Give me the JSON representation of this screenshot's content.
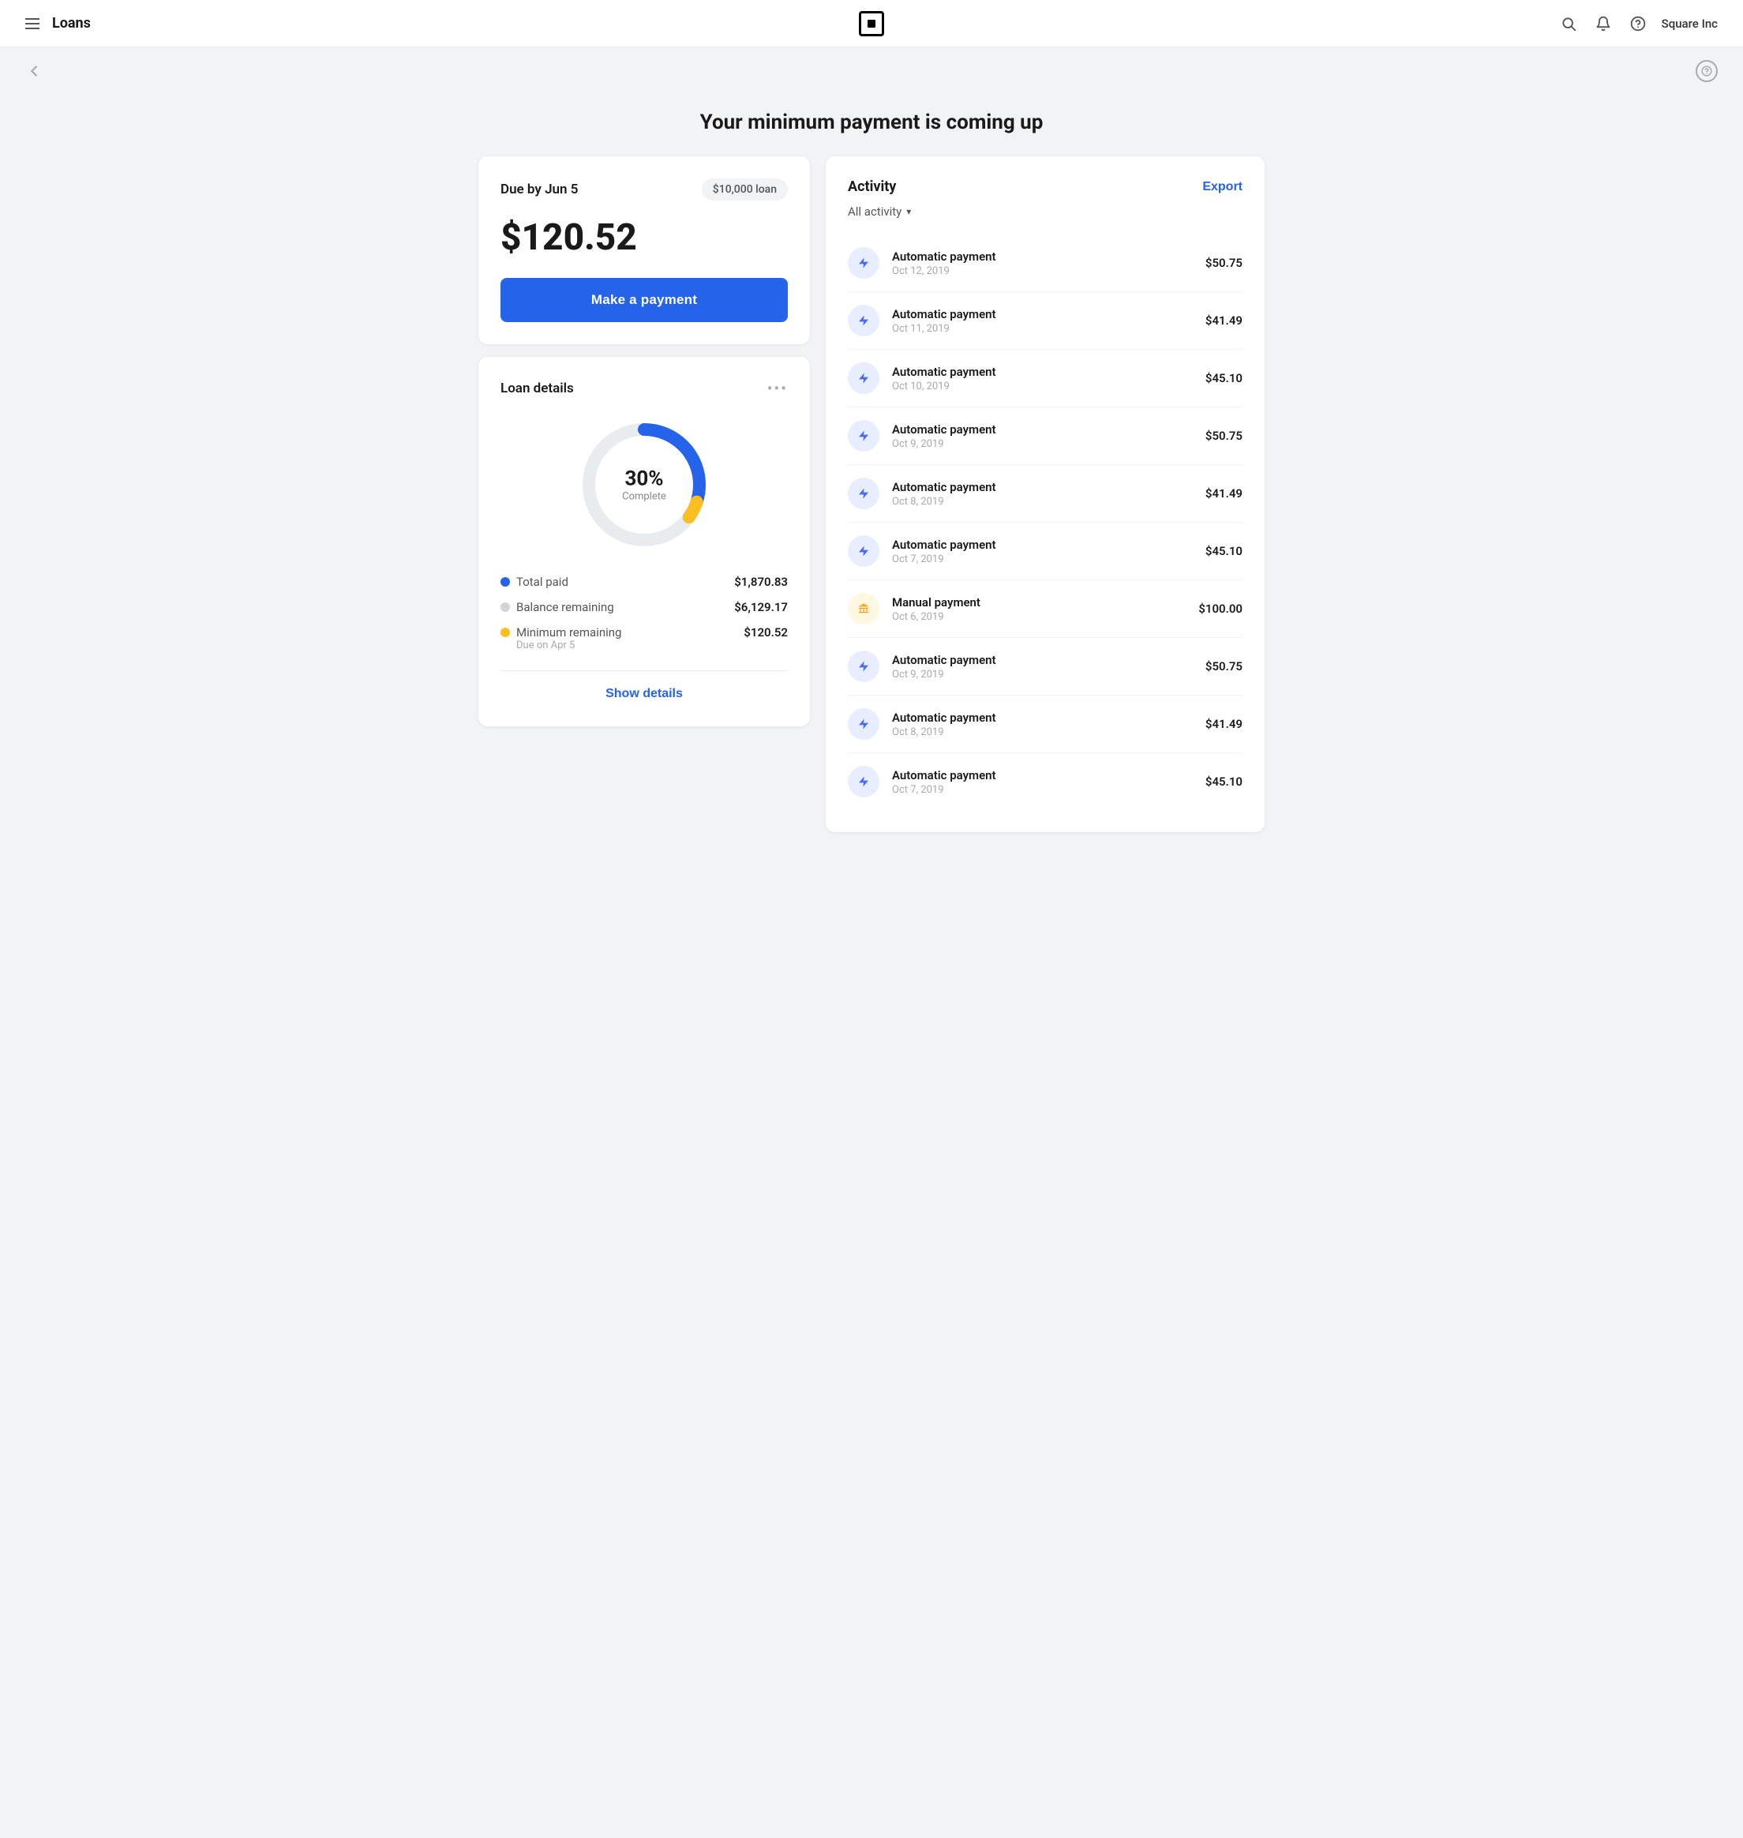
{
  "header": {
    "menu_icon": "☰",
    "title": "Loans",
    "logo_label": "Square logo",
    "search_icon": "🔍",
    "bell_icon": "🔔",
    "help_icon": "?",
    "user": "Square Inc"
  },
  "nav": {
    "back_icon": "←",
    "help_icon": "?"
  },
  "page": {
    "title": "Your minimum payment is coming up"
  },
  "payment_card": {
    "due_label": "Due by Jun 5",
    "loan_badge": "$10,000 loan",
    "amount": "$120.52",
    "button_label": "Make a payment"
  },
  "loan_details_card": {
    "title": "Loan details",
    "more_icon": "•••",
    "donut": {
      "percent": "30%",
      "label": "Complete",
      "total_paid_pct": 30,
      "minimum_pct": 5
    },
    "legend": [
      {
        "dot_color": "#2563eb",
        "label": "Total paid",
        "value": "$1,870.83"
      },
      {
        "dot_color": "#d1d5db",
        "label": "Balance remaining",
        "value": "$6,129.17"
      },
      {
        "dot_color": "#fbbf24",
        "label": "Minimum remaining",
        "sublabel": "Due on Apr 5",
        "value": "$120.52"
      }
    ],
    "show_details_label": "Show details"
  },
  "activity": {
    "title": "Activity",
    "export_label": "Export",
    "filter_label": "All activity",
    "items": [
      {
        "type": "auto",
        "name": "Automatic payment",
        "date": "Oct 12, 2019",
        "amount": "$50.75"
      },
      {
        "type": "auto",
        "name": "Automatic payment",
        "date": "Oct 11, 2019",
        "amount": "$41.49"
      },
      {
        "type": "auto",
        "name": "Automatic payment",
        "date": "Oct 10, 2019",
        "amount": "$45.10"
      },
      {
        "type": "auto",
        "name": "Automatic payment",
        "date": "Oct 9, 2019",
        "amount": "$50.75"
      },
      {
        "type": "auto",
        "name": "Automatic payment",
        "date": "Oct 8, 2019",
        "amount": "$41.49"
      },
      {
        "type": "auto",
        "name": "Automatic payment",
        "date": "Oct 7, 2019",
        "amount": "$45.10"
      },
      {
        "type": "manual",
        "name": "Manual payment",
        "date": "Oct 6, 2019",
        "amount": "$100.00"
      },
      {
        "type": "auto",
        "name": "Automatic payment",
        "date": "Oct 9, 2019",
        "amount": "$50.75"
      },
      {
        "type": "auto",
        "name": "Automatic payment",
        "date": "Oct 8, 2019",
        "amount": "$41.49"
      },
      {
        "type": "auto",
        "name": "Automatic payment",
        "date": "Oct 7, 2019",
        "amount": "$45.10"
      }
    ]
  }
}
